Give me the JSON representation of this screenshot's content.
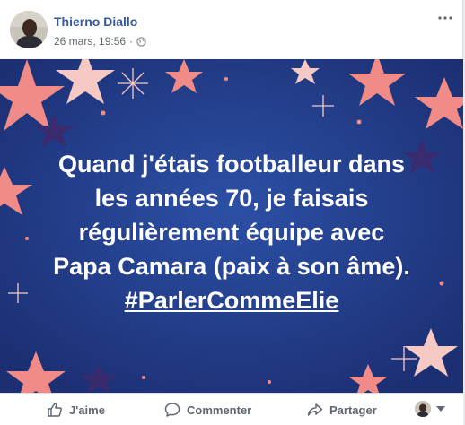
{
  "post": {
    "author": "Thierno Diallo",
    "date": "26 mars, 19:56",
    "separator": "·",
    "privacy_icon": "globe-icon",
    "more_icon": "more-options-icon",
    "text_lines": [
      "Quand j'étais footballeur dans",
      "les années 70, je faisais",
      "régulièrement équipe avec",
      "Papa Camara (paix à son âme)."
    ],
    "hashtag": "#ParlerCommeElie",
    "background_color": "#233f8e",
    "star_color": "#f08b87"
  },
  "actions": {
    "like_label": "J'aime",
    "comment_label": "Commenter",
    "share_label": "Partager"
  },
  "colors": {
    "author_link": "#365899",
    "meta_text": "#616770",
    "action_text": "#606770"
  }
}
